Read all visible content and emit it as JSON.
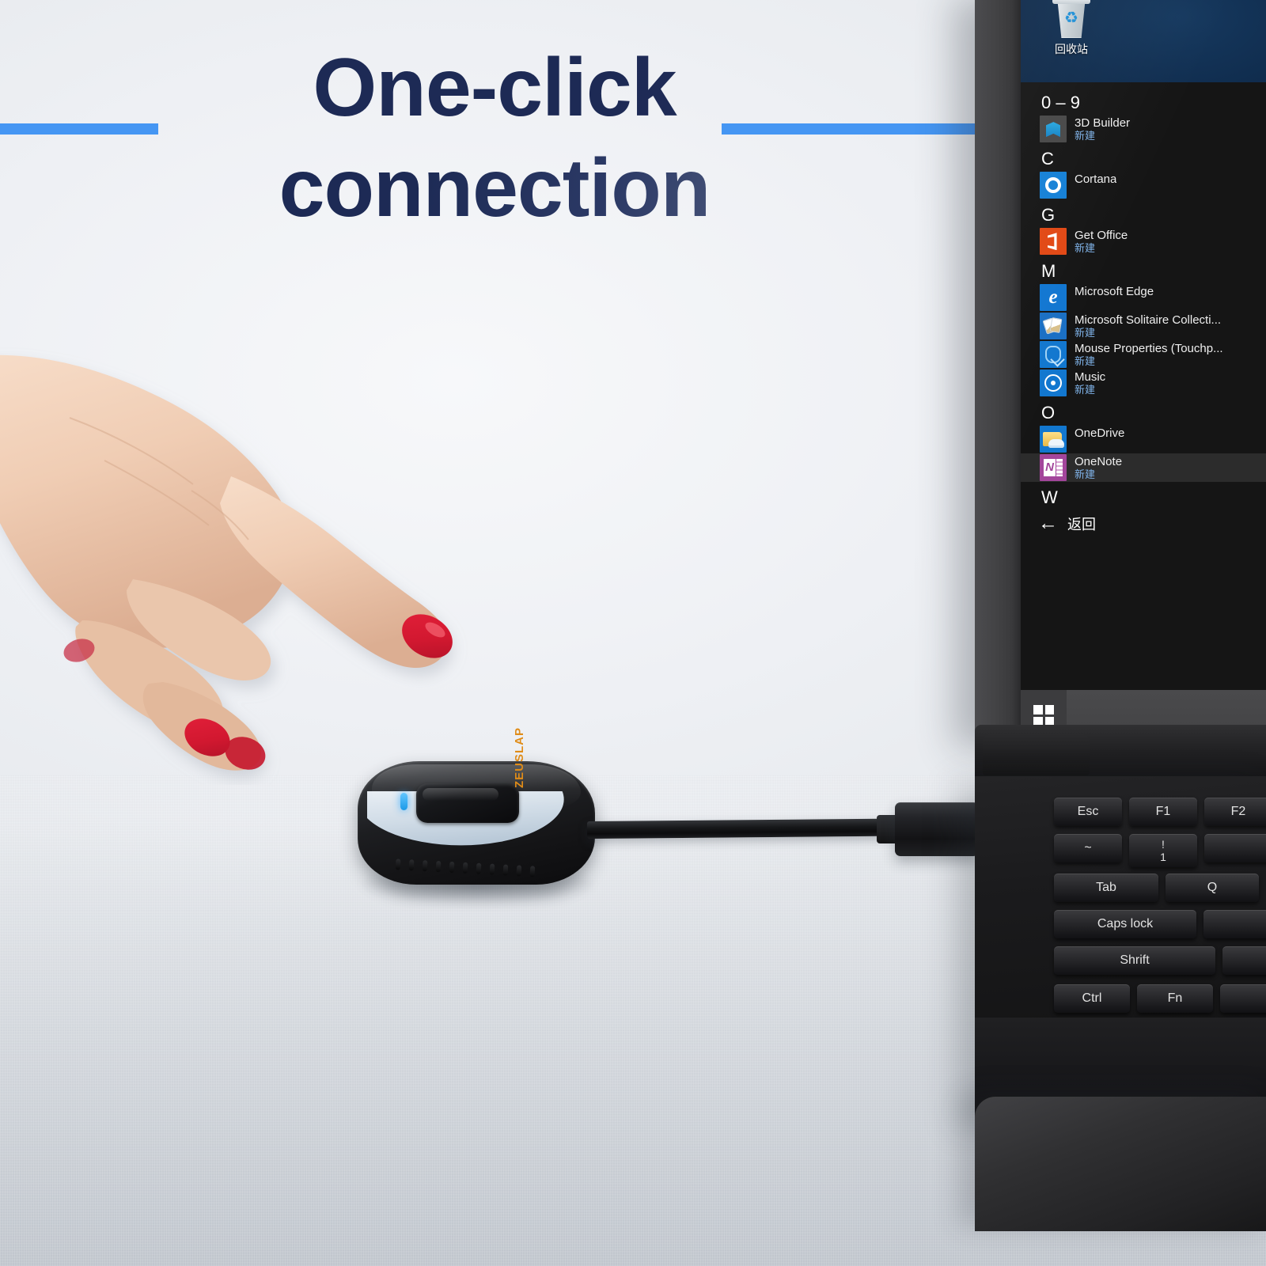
{
  "headline": {
    "line1": "One-click",
    "line2": "connection",
    "accent_color": "#4596f3",
    "text_color_start": "#1d2a55",
    "text_color_end": "#8d95ab"
  },
  "device": {
    "brand": "ZEUSLAP",
    "brand_color": "#e08c18",
    "led_color": "#3caaff",
    "led_name": "status-led"
  },
  "laptop": {
    "desktop": {
      "recycle_bin_label": "回收站",
      "wallpaper_color": "#0e2a4c"
    },
    "start_menu": {
      "groups": [
        {
          "letter": "0 – 9"
        },
        {
          "letter": "C"
        },
        {
          "letter": "G"
        },
        {
          "letter": "M"
        },
        {
          "letter": "O"
        },
        {
          "letter": "W"
        }
      ],
      "apps": [
        {
          "name": "3D Builder",
          "sub": "新建",
          "icon": "3d-builder-icon"
        },
        {
          "name": "Cortana",
          "sub": "",
          "icon": "cortana-icon"
        },
        {
          "name": "Get Office",
          "sub": "新建",
          "icon": "get-office-icon"
        },
        {
          "name": "Microsoft Edge",
          "sub": "",
          "icon": "edge-icon"
        },
        {
          "name": "Microsoft Solitaire Collecti...",
          "sub": "新建",
          "icon": "solitaire-icon"
        },
        {
          "name": "Mouse Properties (Touchp...",
          "sub": "新建",
          "icon": "mouse-properties-icon"
        },
        {
          "name": "Music",
          "sub": "新建",
          "icon": "music-icon"
        },
        {
          "name": "OneDrive",
          "sub": "",
          "icon": "onedrive-icon"
        },
        {
          "name": "OneNote",
          "sub": "新建",
          "icon": "onenote-icon"
        }
      ],
      "back_label": "返回",
      "back_icon": "back-arrow-icon",
      "selected_app": "OneNote"
    },
    "taskbar": {
      "start_button_icon": "windows-logo-icon"
    },
    "keyboard": {
      "row_fn": [
        "Esc",
        "F1",
        "F2"
      ],
      "row_num_tilde": "~",
      "row_num_one_top": "!",
      "row_num_one_bottom": "1",
      "row_tab": [
        "Tab",
        "Q"
      ],
      "row_caps": [
        "Caps lock"
      ],
      "row_shift": [
        "Shrift"
      ],
      "row_ctrl": [
        "Ctrl",
        "Fn"
      ]
    }
  }
}
